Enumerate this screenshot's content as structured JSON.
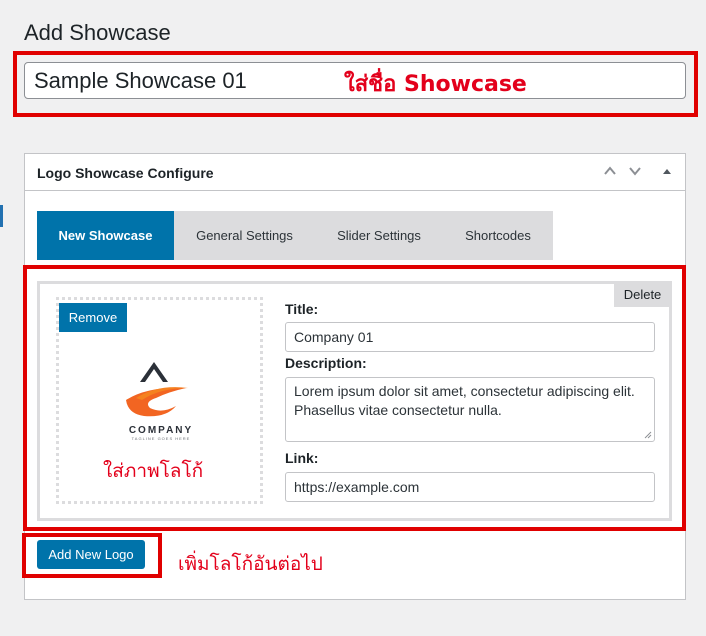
{
  "page": {
    "title": "Add Showcase"
  },
  "showcase_name": {
    "value": "Sample Showcase 01"
  },
  "annotations": {
    "name_hint_prefix": "ใส่ชื่อ",
    "name_hint_word": "Showcase",
    "image_hint": "ใส่ภาพโลโก้",
    "add_hint": "เพิ่มโลโก้อันต่อไป"
  },
  "metabox": {
    "title": "Logo Showcase Configure",
    "icons": [
      "chevron-up-icon",
      "chevron-down-icon",
      "toggle-arrow-icon"
    ]
  },
  "tabs": [
    {
      "label": "New Showcase",
      "active": true
    },
    {
      "label": "General Settings",
      "active": false
    },
    {
      "label": "Slider Settings",
      "active": false
    },
    {
      "label": "Shortcodes",
      "active": false
    }
  ],
  "logo_item": {
    "delete_label": "Delete",
    "remove_label": "Remove",
    "logo": {
      "name": "COMPANY",
      "tagline": "TAGLINE GOES HERE"
    },
    "title_label": "Title:",
    "title_value": "Company 01",
    "description_label": "Description:",
    "description_value": "Lorem ipsum dolor sit amet, consectetur adipiscing elit. Phasellus vitae consectetur nulla.",
    "link_label": "Link:",
    "link_value": "https://example.com"
  },
  "add_new_logo_label": "Add New Logo",
  "colors": {
    "primary": "#0073aa",
    "annotation": "#e3001b",
    "annotation_box": "#e00000"
  }
}
